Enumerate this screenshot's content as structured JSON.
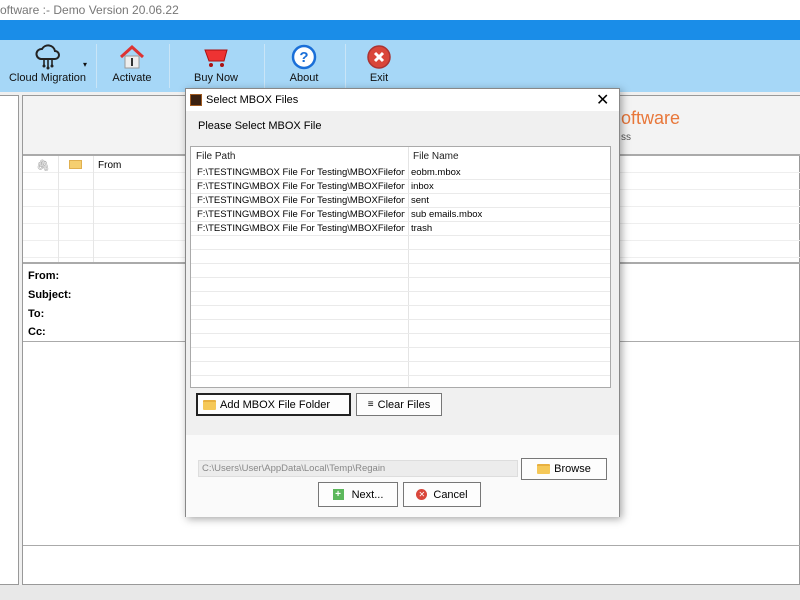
{
  "window": {
    "title": "oftware :- Demo Version 20.06.22"
  },
  "toolbar": {
    "items": [
      {
        "label": "Cloud Migration",
        "icon": "cloud-icon"
      },
      {
        "label": "Activate",
        "icon": "home-key-icon"
      },
      {
        "label": "Buy Now",
        "icon": "cart-icon"
      },
      {
        "label": "About",
        "icon": "help-icon"
      },
      {
        "label": "Exit",
        "icon": "close-circle-icon"
      }
    ]
  },
  "main": {
    "brand": "oftware",
    "brand_sub": "ss",
    "grid_header_from": "From",
    "preview": {
      "from": "From:",
      "subject": "Subject:",
      "to": "To:",
      "cc": "Cc:"
    }
  },
  "dialog": {
    "title": "Select MBOX Files",
    "instruction": "Please Select MBOX File",
    "columns": [
      "File Path",
      "File Name"
    ],
    "rows": [
      {
        "path": "F:\\TESTING\\MBOX File For Testing\\MBOXFilefort...",
        "name": "eobm.mbox"
      },
      {
        "path": "F:\\TESTING\\MBOX File For Testing\\MBOXFilefort...",
        "name": "inbox"
      },
      {
        "path": "F:\\TESTING\\MBOX File For Testing\\MBOXFilefort...",
        "name": "sent"
      },
      {
        "path": "F:\\TESTING\\MBOX File For Testing\\MBOXFilefort...",
        "name": "sub emails.mbox"
      },
      {
        "path": "F:\\TESTING\\MBOX File For Testing\\MBOXFilefort...",
        "name": "trash"
      }
    ],
    "add_folder": "Add MBOX File Folder",
    "clear_files": "Clear Files",
    "temp_path": "C:\\Users\\User\\AppData\\Local\\Temp\\Regain",
    "browse": "Browse",
    "next": "Next...",
    "cancel": "Cancel"
  },
  "colors": {
    "accent": "#1a8de8",
    "toolbar": "#a6d7f7",
    "brand": "#e8773a"
  }
}
